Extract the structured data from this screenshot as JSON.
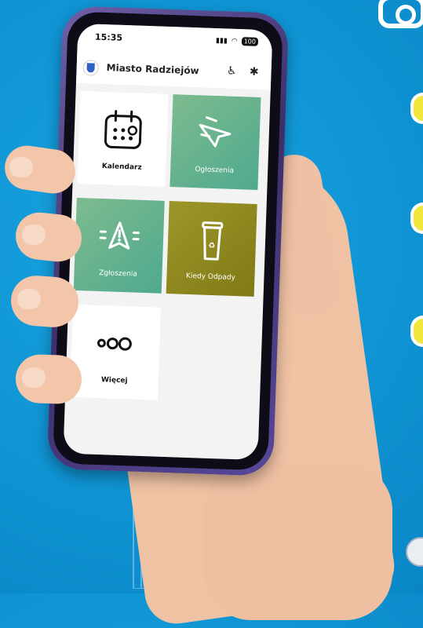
{
  "status_bar": {
    "time": "15:35",
    "battery": "100"
  },
  "app_bar": {
    "title": "Miasto Radziejów"
  },
  "tiles": [
    {
      "label": "Kalendarz",
      "icon": "calendar-icon"
    },
    {
      "label": "Ogłoszenia",
      "icon": "megaphone-icon"
    },
    {
      "label": "Zgłoszenia",
      "icon": "alert-icon"
    },
    {
      "label": "Kiedy Odpady",
      "icon": "trash-bin-icon"
    },
    {
      "label": "Więcej",
      "icon": "more-icon"
    }
  ],
  "colors": {
    "background": "#1197d6",
    "tile_green": "#5fb08f",
    "tile_olive": "#8f891f",
    "phone_frame": "#4a3b84"
  }
}
